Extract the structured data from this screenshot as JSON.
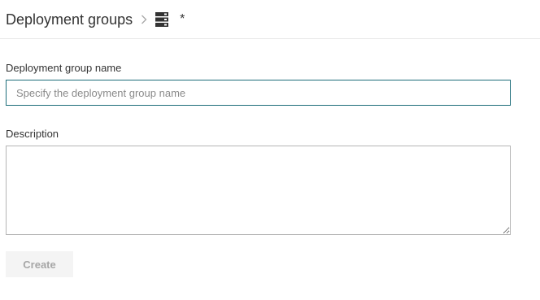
{
  "breadcrumb": {
    "root": "Deployment groups",
    "separator_icon": "chevron-right-icon",
    "item_icon": "server-icon",
    "current": "*"
  },
  "form": {
    "name_label": "Deployment group name",
    "name_placeholder": "Specify the deployment group name",
    "name_value": "",
    "description_label": "Description",
    "description_value": "",
    "create_label": "Create"
  },
  "colors": {
    "input_focus_border": "#1d6d7a",
    "textarea_border": "#b5b5b5",
    "button_disabled_bg": "#f4f4f4",
    "button_disabled_text": "#a6a6a6",
    "header_divider": "#eaeaea"
  }
}
